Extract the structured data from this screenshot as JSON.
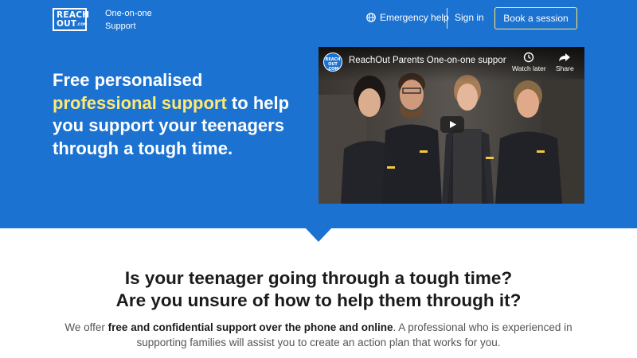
{
  "colors": {
    "hero_bg": "#1c72d0",
    "highlight": "#ffe873",
    "button_border": "#ffe873",
    "text_dark": "#1b1b1b",
    "text_muted": "#555555"
  },
  "header": {
    "logo_line1": "REACH",
    "logo_line2": "OUT",
    "logo_suffix": ".COM",
    "tagline": "One-on-one Support",
    "emergency_label": "Emergency help",
    "emergency_icon": "globe-icon",
    "signin_label": "Sign in",
    "book_label": "Book a session"
  },
  "hero": {
    "headline_pre": "Free personalised",
    "headline_highlight": "professional support",
    "headline_mid": "to",
    "headline_post": "help you support your teenagers through a tough time."
  },
  "video": {
    "channel_badge_line1": "REACH",
    "channel_badge_line2": "OUT",
    "channel_badge_line3": ".COM",
    "title": "ReachOut Parents One-on-one support | ReachOut Parents",
    "watch_later_label": "Watch later",
    "share_label": "Share",
    "play_icon": "play-icon"
  },
  "section": {
    "question_line1": "Is your teenager going through a tough time?",
    "question_line2": "Are you unsure of how to help them through it?",
    "desc_pre": "We offer ",
    "desc_bold": "free and confidential support over the phone and online",
    "desc_post": ". A professional who is experienced in supporting families will assist you to create an action plan that works for you."
  }
}
